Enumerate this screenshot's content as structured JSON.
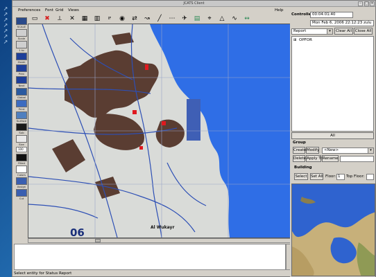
{
  "window": {
    "title": "JCATS Client"
  },
  "menu": {
    "items": [
      "Preferences",
      "Font",
      "Grid",
      "Views"
    ],
    "help": "Help"
  },
  "desktop_icons": [
    "arrow-icon",
    "arrow-icon",
    "arrow-icon",
    "arrow-icon",
    "arrow-icon",
    "arrow-icon",
    "arrow-icon"
  ],
  "palette": {
    "items": [
      {
        "label": "SCALE",
        "icon": "scale-icon",
        "color": "#2a4a8a"
      },
      {
        "label": "Scale",
        "icon": "scale-toggle-icon",
        "color": "#cfcfcf"
      },
      {
        "label": "1 to",
        "icon": "ratio-icon",
        "color": "#cfcfcf"
      },
      {
        "label": "Zoom",
        "icon": "zoom-icon",
        "color": "#1e3f9a"
      },
      {
        "label": "Prev",
        "icon": "prev-icon",
        "color": "#1e3f9a"
      },
      {
        "label": "Next",
        "icon": "next-icon",
        "color": "#1e3f9a"
      },
      {
        "label": "Global",
        "icon": "global-icon",
        "color": "#2a5aa0"
      },
      {
        "label": "Print",
        "icon": "print-icon",
        "color": "#3d6cc0"
      },
      {
        "label": "Surface",
        "icon": "surface-icon",
        "color": "#4f7fbf"
      },
      {
        "label": "Sub",
        "icon": "sub-icon",
        "color": "#1a1a1a"
      },
      {
        "label": "Size",
        "icon": "size-icon",
        "color": "#e8e8e8"
      },
      {
        "label": "Filled",
        "icon": "filled-icon",
        "color": "#111111"
      },
      {
        "label": "Colors",
        "icon": "colors-icon",
        "color": "#ffffff"
      },
      {
        "label": "Assign",
        "icon": "assign-icon",
        "color": "#3a5fb0"
      },
      {
        "label": "Cut",
        "icon": "cut-icon",
        "color": "#3a5fb0"
      }
    ],
    "size_value": "100"
  },
  "toolbar": {
    "icons": [
      "select-icon",
      "cancel-icon",
      "measure-icon",
      "crosshair-icon",
      "grid-icon",
      "layer-icon",
      "iff-icon",
      "eye-icon",
      "move-icon",
      "route-icon",
      "line-icon",
      "dots-icon",
      "plane-icon",
      "building-icon",
      "waypoint-icon",
      "triangle-icon",
      "wave-icon",
      "trail-icon"
    ],
    "colors": {
      "cancel": "#d71f1f",
      "accent": "#2e8b57"
    }
  },
  "map": {
    "labels": [
      "Al Wukayr",
      "06"
    ],
    "colors": {
      "water": "#2f6ee6",
      "urban": "#5a3d32",
      "land": "#d9dbd8",
      "roads": "#2d4fb5",
      "grid": "#9aa5c8",
      "markers": "#e0191f"
    }
  },
  "right_panel": {
    "controller_label": "Controller",
    "controller_value": "00:04:01:40",
    "datetime": "Mon Feb 6, 2006 22:12:23 zulu",
    "report_select": "Report",
    "clear_all": "Clear All",
    "close_all": "Close All",
    "tree_root": "OPFOR",
    "all_button": "All",
    "group_label": "Group",
    "create_button": "Create",
    "modify_button": "Modify",
    "group_select": "<New>",
    "delete_button": "Delete",
    "apply_to_button": "Apply To",
    "rename_button": "Rename",
    "building_label": "Building",
    "select_button": "Select",
    "set_all_button": "Set All",
    "floor_label": "Floor:",
    "floor_value": "1",
    "top_floor_label": "Top Floor:",
    "top_floor_value": ""
  },
  "status_bar": {
    "text": "Select entity for Status Report"
  }
}
